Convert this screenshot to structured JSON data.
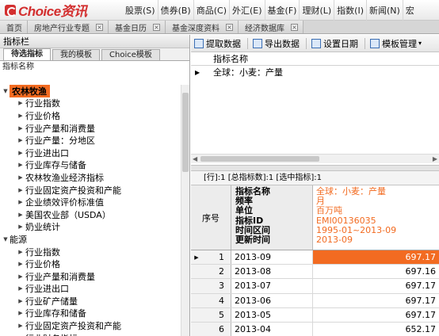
{
  "app": {
    "logo_text": "Choice资讯",
    "menu": [
      "股票(S)",
      "债券(B)",
      "商品(C)",
      "外汇(E)",
      "基金(F)",
      "理财(L)",
      "指数(I)",
      "新闻(N)",
      "宏"
    ]
  },
  "tabs": [
    {
      "label": "首页"
    },
    {
      "label": "房地产行业专题"
    },
    {
      "label": "基金日历"
    },
    {
      "label": "基金深度资料"
    },
    {
      "label": "经济数据库"
    }
  ],
  "left_panel": {
    "title": "指标栏",
    "subtabs": [
      "待选指标",
      "我的模板",
      "Choice模板"
    ],
    "tree_header": "指标名称",
    "tree": [
      {
        "type": "cat",
        "label": "农林牧渔",
        "selected": true
      },
      {
        "type": "child",
        "label": "行业指数"
      },
      {
        "type": "child",
        "label": "行业价格"
      },
      {
        "type": "child",
        "label": "行业产量和消费量"
      },
      {
        "type": "child",
        "label": "行业产量：分地区"
      },
      {
        "type": "child",
        "label": "行业进出口"
      },
      {
        "type": "child",
        "label": "行业库存与储备"
      },
      {
        "type": "child",
        "label": "农林牧渔业经济指标"
      },
      {
        "type": "child",
        "label": "行业固定资产投资和产能"
      },
      {
        "type": "child",
        "label": "企业绩效评价标准值"
      },
      {
        "type": "child",
        "label": "美国农业部（USDA）"
      },
      {
        "type": "child",
        "label": "奶业统计"
      },
      {
        "type": "cat",
        "label": "能源"
      },
      {
        "type": "child",
        "label": "行业指数"
      },
      {
        "type": "child",
        "label": "行业价格"
      },
      {
        "type": "child",
        "label": "行业产量和消费量"
      },
      {
        "type": "child",
        "label": "行业进出口"
      },
      {
        "type": "child",
        "label": "行业矿产储量"
      },
      {
        "type": "child",
        "label": "行业库存和储备"
      },
      {
        "type": "child",
        "label": "行业固定资产投资和产能"
      },
      {
        "type": "child",
        "label": "行业财务指标"
      }
    ]
  },
  "toolbar": {
    "extract": "提取数据",
    "export": "导出数据",
    "set_date": "设置日期",
    "template": "模板管理"
  },
  "indicator_list": {
    "header": "指标名称",
    "rows": [
      "全球：小麦：产量"
    ]
  },
  "counts": {
    "text": "[行]:1 [总指标数]:1 [选中指标]:1"
  },
  "grid": {
    "seq_header": "序号",
    "meta_header": [
      "指标名称",
      "频率",
      "单位",
      "指标ID",
      "时间区间",
      "更新时间"
    ],
    "series_info": [
      "全球：小麦：产量",
      "月",
      "百万吨",
      "EMI00136035",
      "1995-01~2013-09",
      "2013-09"
    ],
    "rows": [
      {
        "seq": "1",
        "date": "2013-09",
        "value": "697.17",
        "selected": true
      },
      {
        "seq": "2",
        "date": "2013-08",
        "value": "697.16"
      },
      {
        "seq": "3",
        "date": "2013-07",
        "value": "697.17"
      },
      {
        "seq": "4",
        "date": "2013-06",
        "value": "697.17"
      },
      {
        "seq": "5",
        "date": "2013-05",
        "value": "697.17"
      },
      {
        "seq": "6",
        "date": "2013-04",
        "value": "652.17"
      }
    ]
  },
  "colors": {
    "accent": "#f26b21",
    "brand": "#d32f2f"
  }
}
